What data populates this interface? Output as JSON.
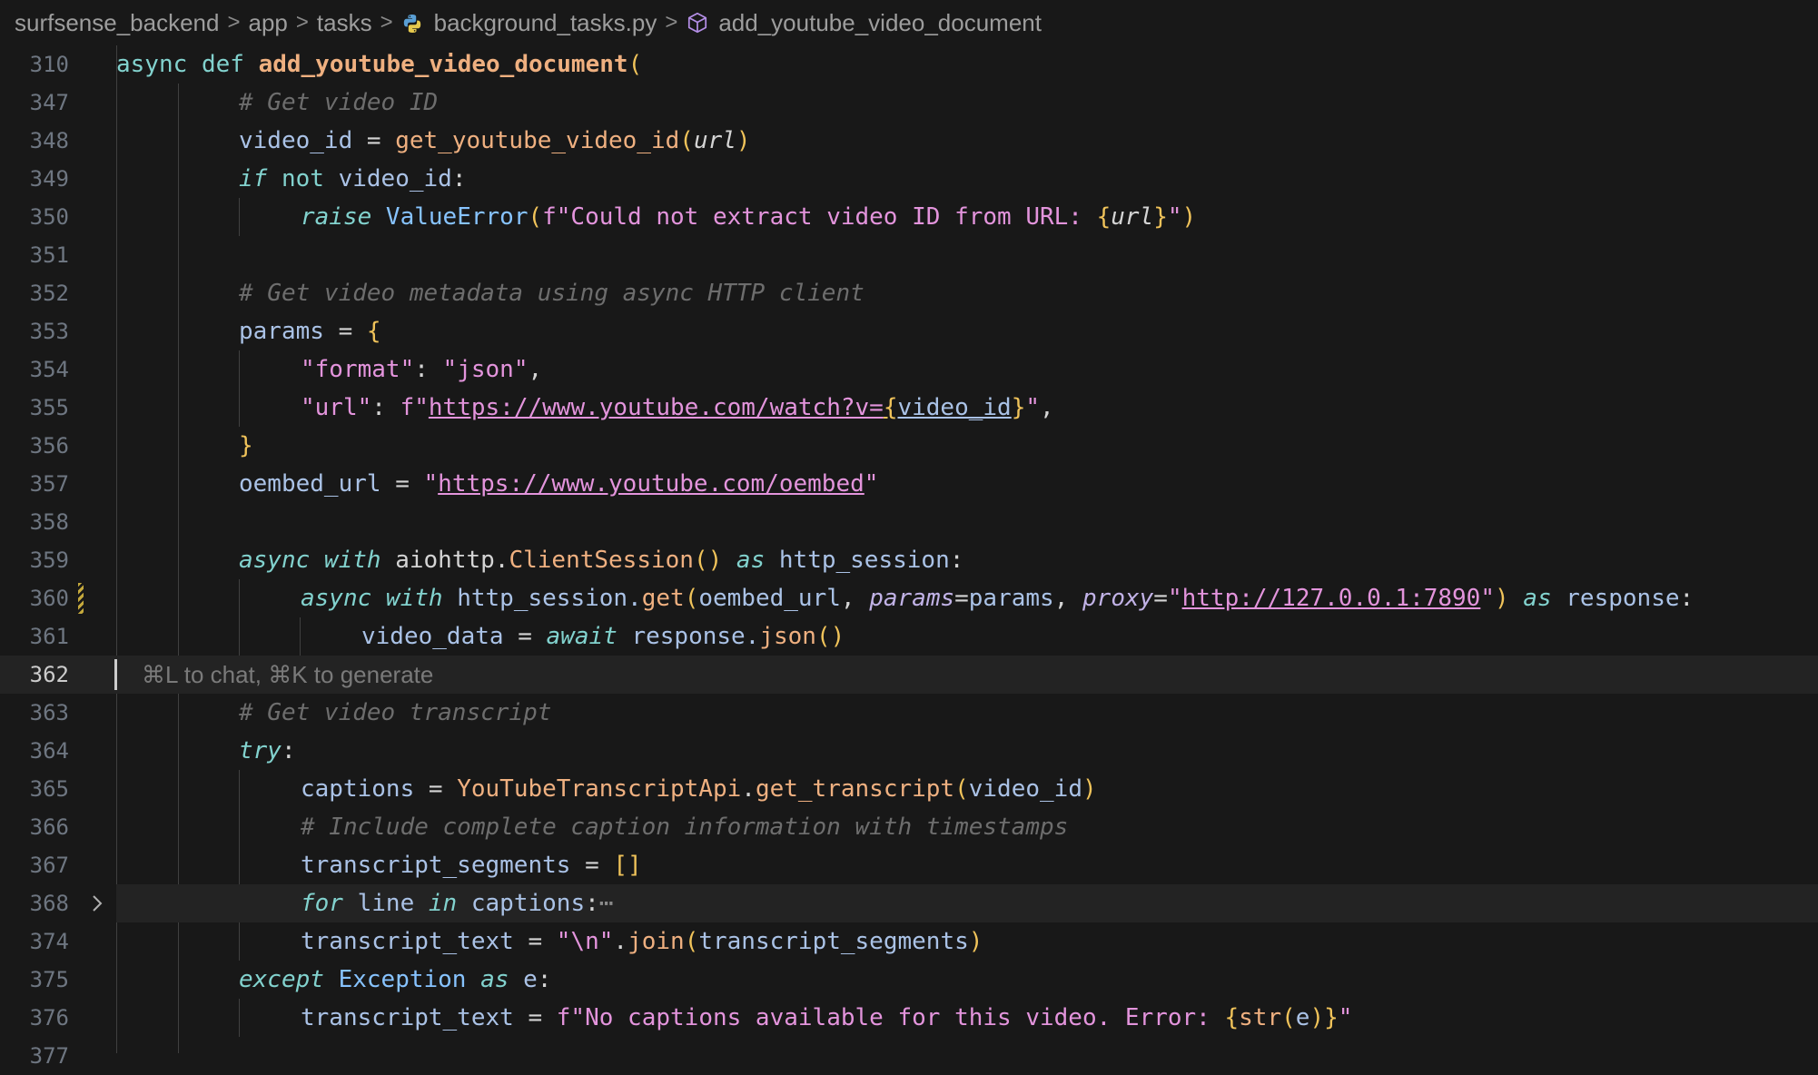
{
  "breadcrumb": {
    "items": [
      "surfsense_backend",
      "app",
      "tasks",
      "background_tasks.py",
      "add_youtube_video_document"
    ],
    "separator": ">"
  },
  "editor": {
    "line_numbers": [
      "310",
      "347",
      "348",
      "349",
      "350",
      "351",
      "352",
      "353",
      "354",
      "355",
      "356",
      "357",
      "358",
      "359",
      "360",
      "361",
      "362",
      "363",
      "364",
      "365",
      "366",
      "367",
      "368",
      "374",
      "375",
      "376",
      "377"
    ],
    "active_line": "362",
    "inline_hint": "⌘L to chat, ⌘K to generate",
    "lines": {
      "l310": {
        "a": "async",
        "b": "def",
        "c": "add_youtube_video_document",
        "d": "("
      },
      "l347": {
        "a": "# Get video ID"
      },
      "l348": {
        "a": "video_id",
        "b": " = ",
        "c": "get_youtube_video_id",
        "d": "(",
        "e": "url",
        "f": ")"
      },
      "l349": {
        "a": "if",
        "b": " not ",
        "c": "video_id",
        "d": ":"
      },
      "l350": {
        "a": "raise",
        "b": " ValueError",
        "c": "(",
        "d": "f\"Could not extract video ID from URL: ",
        "e": "{",
        "f": "url",
        "g": "}",
        "h": "\"",
        "i": ")"
      },
      "l352": {
        "a": "# Get video metadata using async HTTP client"
      },
      "l353": {
        "a": "params",
        "b": " = ",
        "c": "{"
      },
      "l354": {
        "a": "\"format\"",
        "b": ": ",
        "c": "\"json\"",
        "d": ","
      },
      "l355": {
        "a": "\"url\"",
        "b": ": ",
        "c": "f\"",
        "d": "https://www.youtube.com/watch?v=",
        "e": "{",
        "f": "video_id",
        "g": "}",
        "h": "\"",
        "i": ","
      },
      "l356": {
        "a": "}"
      },
      "l357": {
        "a": "oembed_url",
        "b": " = ",
        "c": "\"",
        "d": "https://www.youtube.com/oembed",
        "e": "\""
      },
      "l359": {
        "a": "async",
        "b": " with",
        "c": " aiohttp.",
        "d": "ClientSession",
        "e": "()",
        "f": " as",
        "g": " http_session",
        "h": ":"
      },
      "l360": {
        "a": "async",
        "b": " with",
        "c": " http_session.",
        "d": "get",
        "e": "(",
        "f": "oembed_url",
        "g": ", ",
        "h": "params",
        "i": "=",
        "j": "params",
        "k": ", ",
        "l": "proxy",
        "m": "=",
        "n": "\"",
        "o": "http://127.0.0.1:7890",
        "p": "\"",
        "q": ")",
        "r": " as",
        "s": " response",
        "t": ":"
      },
      "l361": {
        "a": "video_data",
        "b": " = ",
        "c": "await",
        "d": " response.",
        "e": "json",
        "f": "()"
      },
      "l363": {
        "a": "# Get video transcript"
      },
      "l364": {
        "a": "try",
        "b": ":"
      },
      "l365": {
        "a": "captions",
        "b": " = ",
        "c": "YouTubeTranscriptApi",
        "d": ".",
        "e": "get_transcript",
        "f": "(",
        "g": "video_id",
        "h": ")"
      },
      "l366": {
        "a": "# Include complete caption information with timestamps"
      },
      "l367": {
        "a": "transcript_segments",
        "b": " = ",
        "c": "[]"
      },
      "l368": {
        "a": "for",
        "b": " line",
        "c": " in",
        "d": " captions",
        "e": ":",
        "f": "⋯"
      },
      "l374": {
        "a": "transcript_text",
        "b": " = ",
        "c": "\"\\n\"",
        "d": ".",
        "e": "join",
        "f": "(",
        "g": "transcript_segments",
        "h": ")"
      },
      "l375": {
        "a": "except",
        "b": " Exception",
        "c": " as",
        "d": " e",
        "e": ":"
      },
      "l376": {
        "a": "transcript_text",
        "b": " = ",
        "c": "f\"No captions available for this video. Error: ",
        "d": "{",
        "e": "str",
        "f": "(",
        "g": "e",
        "h": ")",
        "i": "}",
        "j": "\""
      }
    }
  },
  "icons": {
    "python": "python-file-icon",
    "symbol": "method-cube-icon",
    "fold": "chevron-right-icon"
  },
  "colors": {
    "background": "#181818",
    "keyword": "#82d2ce",
    "function": "#efb080",
    "variable": "#aac2e6",
    "string": "#e394dc",
    "comment": "#6d6d6d",
    "bracket": "#f0c35a"
  }
}
